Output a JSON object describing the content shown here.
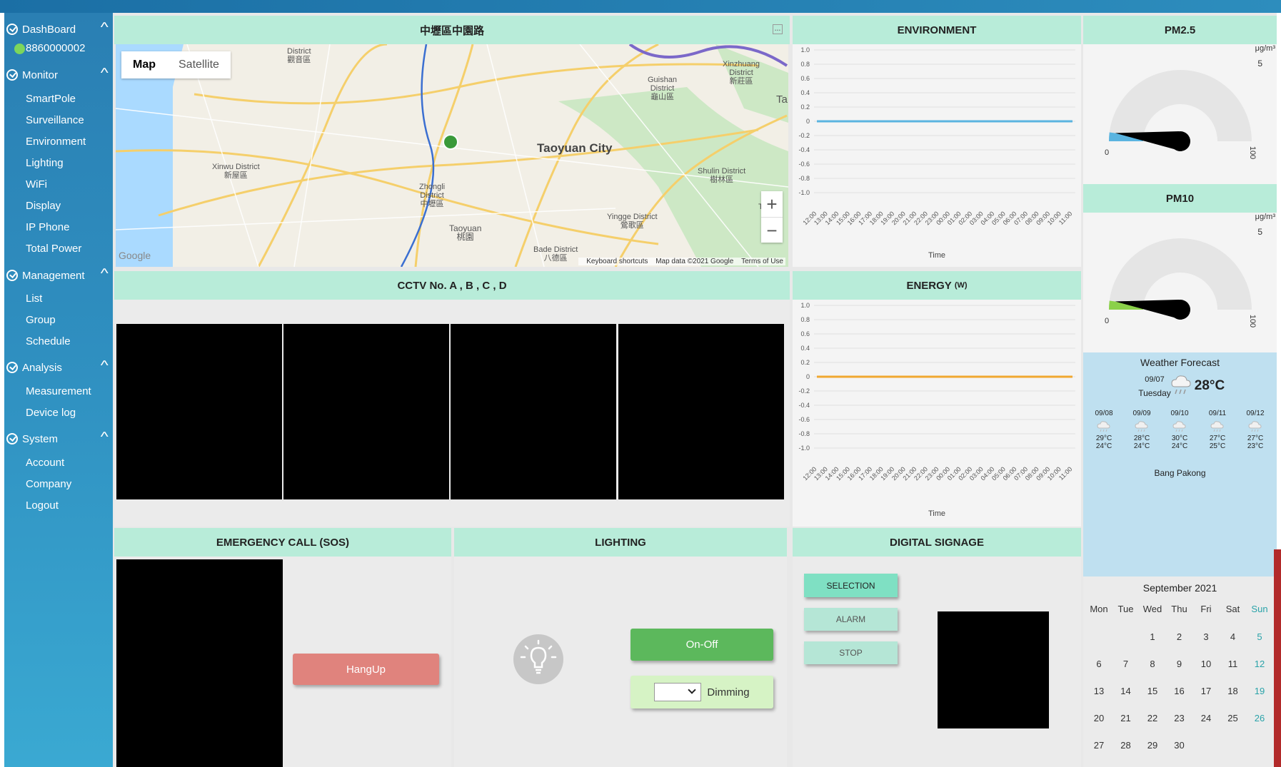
{
  "sidebar": {
    "groups": [
      {
        "label": "DashBoard"
      },
      {
        "label": "Monitor",
        "items": [
          "SmartPole",
          "Surveillance",
          "Environment",
          "Lighting",
          "WiFi",
          "Display",
          "IP Phone",
          "Total Power"
        ]
      },
      {
        "label": "Management",
        "items": [
          "List",
          "Group",
          "Schedule"
        ]
      },
      {
        "label": "Analysis",
        "items": [
          "Measurement",
          "Device log"
        ]
      },
      {
        "label": "System",
        "items": [
          "Account",
          "Company",
          "Logout"
        ]
      }
    ],
    "device_id": "8860000002",
    "chevron": "^"
  },
  "map_panel": {
    "title": "中壢區中園路",
    "toggle": {
      "map": "Map",
      "satellite": "Satellite"
    },
    "zoom_in": "+",
    "zoom_out": "−",
    "footer": {
      "shortcuts": "Keyboard shortcuts",
      "data": "Map data ©2021 Google",
      "terms": "Terms of Use"
    },
    "labels": {
      "taoyuan_city": "Taoyuan City",
      "xinwu": "Xinwu District\n新屋區",
      "zhongli": "Zhongli\nDistrict\n中壢區",
      "taoyuan": "Taoyuan\n桃園",
      "guishan": "Guishan\nDistrict\n龜山區",
      "xinzhuang": "Xinzhuang\nDistrict\n新莊區",
      "shulin": "Shulin District\n樹林區",
      "yingge": "Yingge District\n鶯歌區",
      "bade": "Bade District\n八德區",
      "district_top": "District\n觀音區",
      "google": "Google",
      "ta": "Ta",
      "tao_edge": "Tao\nDi"
    }
  },
  "environment_panel": {
    "title": "ENVIRONMENT",
    "xlabel": "Time"
  },
  "energy_panel": {
    "title": "ENERGY",
    "unit": "(W)",
    "xlabel": "Time"
  },
  "cctv_panel": {
    "title": "CCTV No. A , B , C , D"
  },
  "pm25_panel": {
    "title": "PM2.5",
    "unit": "μg/m³",
    "max": "5",
    "min_label": "0",
    "max_label": "100"
  },
  "pm10_panel": {
    "title": "PM10",
    "unit": "μg/m³",
    "max": "5",
    "min_label": "0",
    "max_label": "100"
  },
  "weather": {
    "title": "Weather Forecast",
    "today_date": "09/07",
    "today_day": "Tuesday",
    "today_temp": "28°C",
    "forecast": [
      {
        "date": "09/08",
        "high": "29°C",
        "low": "24°C"
      },
      {
        "date": "09/09",
        "high": "28°C",
        "low": "24°C"
      },
      {
        "date": "09/10",
        "high": "30°C",
        "low": "24°C"
      },
      {
        "date": "09/11",
        "high": "27°C",
        "low": "25°C"
      },
      {
        "date": "09/12",
        "high": "27°C",
        "low": "23°C"
      }
    ],
    "location": "Bang Pakong"
  },
  "calendar": {
    "title": "September 2021",
    "weekdays": [
      "Mon",
      "Tue",
      "Wed",
      "Thu",
      "Fri",
      "Sat",
      "Sun"
    ],
    "weeks": [
      [
        "",
        "",
        "1",
        "2",
        "3",
        "4",
        "5"
      ],
      [
        "6",
        "7",
        "8",
        "9",
        "10",
        "11",
        "12"
      ],
      [
        "13",
        "14",
        "15",
        "16",
        "17",
        "18",
        "19"
      ],
      [
        "20",
        "21",
        "22",
        "23",
        "24",
        "25",
        "26"
      ],
      [
        "27",
        "28",
        "29",
        "30",
        "",
        "",
        ""
      ]
    ]
  },
  "sos_panel": {
    "title": "EMERGENCY CALL (SOS)",
    "hangup": "HangUp"
  },
  "lighting_panel": {
    "title": "LIGHTING",
    "onoff": "On-Off",
    "dimming": "Dimming",
    "dimming_value": ""
  },
  "signage_panel": {
    "title": "DIGITAL SIGNAGE",
    "selection": "SELECTION",
    "alarm": "ALARM",
    "stop": "STOP"
  },
  "colors": {
    "sidebar": "#2f8fc0",
    "panel_header": "#b8ecd9",
    "env_line": "#5ab4e0",
    "energy_line": "#f0a830",
    "pm25_fill": "#5ab4e0",
    "pm10_fill": "#8bd14a",
    "hangup": "#e0837d",
    "onoff": "#5cb85c",
    "dimming_bg": "#d6f3c5",
    "selection": "#7fe0c3",
    "signage_btn": "#b5e6d6"
  },
  "chart_data": [
    {
      "type": "line",
      "title": "ENVIRONMENT",
      "xlabel": "Time",
      "ylabel": "",
      "x": [
        "12:00",
        "13:00",
        "14:00",
        "15:00",
        "16:00",
        "17:00",
        "18:00",
        "19:00",
        "20:00",
        "21:00",
        "22:00",
        "23:00",
        "00:00",
        "01:00",
        "02:00",
        "03:00",
        "04:00",
        "05:00",
        "06:00",
        "07:00",
        "08:00",
        "09:00",
        "10:00",
        "11:00"
      ],
      "series": [
        {
          "values": [
            0,
            0,
            0,
            0,
            0,
            0,
            0,
            0,
            0,
            0,
            0,
            0,
            0,
            0,
            0,
            0,
            0,
            0,
            0,
            0,
            0,
            0,
            0,
            0
          ]
        }
      ],
      "yticks": [
        "1.0",
        "0.8",
        "0.6",
        "0.4",
        "0.2",
        "0",
        "-0.2",
        "-0.4",
        "-0.6",
        "-0.8",
        "-1.0"
      ],
      "ylim": [
        -1,
        1
      ],
      "grid": true
    },
    {
      "type": "line",
      "title": "ENERGY",
      "xlabel": "Time",
      "ylabel": "",
      "x": [
        "12:00",
        "13:00",
        "14:00",
        "15:00",
        "16:00",
        "17:00",
        "18:00",
        "19:00",
        "20:00",
        "21:00",
        "22:00",
        "23:00",
        "00:00",
        "01:00",
        "02:00",
        "03:00",
        "04:00",
        "05:00",
        "06:00",
        "07:00",
        "08:00",
        "09:00",
        "10:00",
        "11:00"
      ],
      "series": [
        {
          "values": [
            0,
            0,
            0,
            0,
            0,
            0,
            0,
            0,
            0,
            0,
            0,
            0,
            0,
            0,
            0,
            0,
            0,
            0,
            0,
            0,
            0,
            0,
            0,
            0
          ]
        }
      ],
      "yticks": [
        "1.0",
        "0.8",
        "0.6",
        "0.4",
        "0.2",
        "0",
        "-0.2",
        "-0.4",
        "-0.6",
        "-0.8",
        "-1.0"
      ],
      "ylim": [
        -1,
        1
      ],
      "grid": true
    }
  ],
  "gauges": {
    "pm25": {
      "value_fraction": 0.04,
      "min": 0,
      "max": 100
    },
    "pm10": {
      "value_fraction": 0.04,
      "min": 0,
      "max": 100
    }
  }
}
